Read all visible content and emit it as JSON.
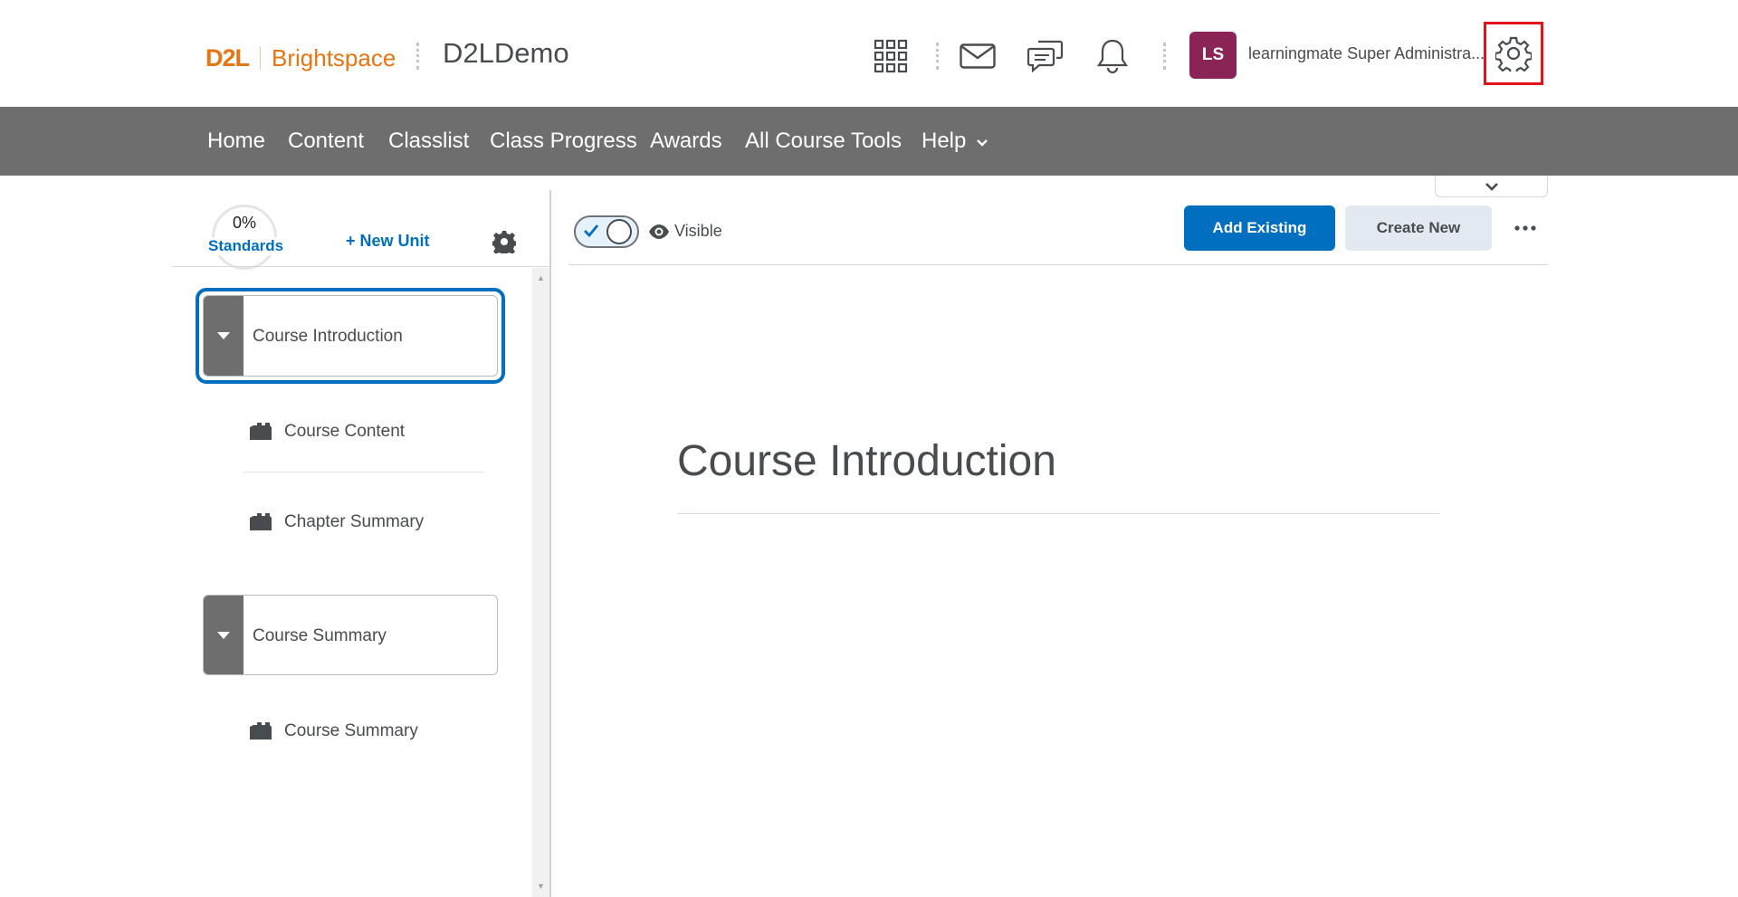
{
  "header": {
    "logo_d2l": "D2L",
    "logo_brand": "Brightspace",
    "org_title": "D2LDemo",
    "user_initials": "LS",
    "user_name": "learningmate Super Administra..."
  },
  "navbar": {
    "items": [
      {
        "label": "Home"
      },
      {
        "label": "Content"
      },
      {
        "label": "Classlist"
      },
      {
        "label": "Class Progress"
      },
      {
        "label": "Awards"
      },
      {
        "label": "All Course Tools"
      },
      {
        "label": "Help"
      }
    ]
  },
  "left_panel": {
    "progress_text": "0%",
    "standards_label": "Standards",
    "new_unit_label": "+ New Unit",
    "units": [
      {
        "label": "Course Introduction",
        "lessons": [
          {
            "label": "Course Content"
          },
          {
            "label": "Chapter Summary"
          }
        ]
      },
      {
        "label": "Course Summary",
        "lessons": [
          {
            "label": "Course Summary"
          }
        ]
      }
    ]
  },
  "toolbar": {
    "visibility_label": "Visible",
    "add_existing_label": "Add Existing",
    "create_new_label": "Create New"
  },
  "main": {
    "title": "Course Introduction"
  },
  "colors": {
    "brand_orange": "#e87511",
    "primary_blue": "#006fbf",
    "navbar_gray": "#6e6e6e",
    "avatar_bg": "#8a2457",
    "highlight_red": "#e4121b"
  }
}
